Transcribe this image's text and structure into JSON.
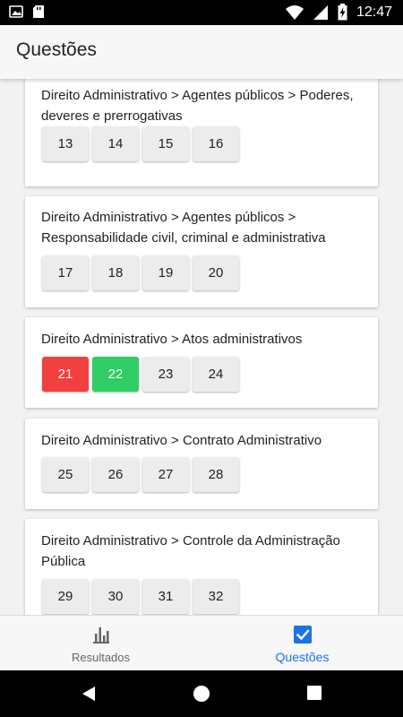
{
  "status_bar": {
    "time": "12:47"
  },
  "app_bar": {
    "title": "Questões"
  },
  "sections": [
    {
      "title": "Direito Administrativo > Agentes públicos > Poderes, deveres e prerrogativas",
      "questions": [
        {
          "n": "13",
          "status": "none"
        },
        {
          "n": "14",
          "status": "none"
        },
        {
          "n": "15",
          "status": "none"
        },
        {
          "n": "16",
          "status": "none"
        }
      ]
    },
    {
      "title": "Direito Administrativo > Agentes públicos > Responsabilidade civil, criminal e administrativa",
      "questions": [
        {
          "n": "17",
          "status": "none"
        },
        {
          "n": "18",
          "status": "none"
        },
        {
          "n": "19",
          "status": "none"
        },
        {
          "n": "20",
          "status": "none"
        }
      ]
    },
    {
      "title": "Direito Administrativo > Atos administrativos",
      "questions": [
        {
          "n": "21",
          "status": "wrong"
        },
        {
          "n": "22",
          "status": "right"
        },
        {
          "n": "23",
          "status": "none"
        },
        {
          "n": "24",
          "status": "none"
        }
      ]
    },
    {
      "title": "Direito Administrativo > Contrato Administrativo",
      "questions": [
        {
          "n": "25",
          "status": "none"
        },
        {
          "n": "26",
          "status": "none"
        },
        {
          "n": "27",
          "status": "none"
        },
        {
          "n": "28",
          "status": "none"
        }
      ]
    },
    {
      "title": "Direito Administrativo > Controle da Administração Pública",
      "questions": [
        {
          "n": "29",
          "status": "none"
        },
        {
          "n": "30",
          "status": "none"
        },
        {
          "n": "31",
          "status": "none"
        },
        {
          "n": "32",
          "status": "none"
        }
      ]
    }
  ],
  "bottom_nav": {
    "items": [
      {
        "label": "Resultados",
        "icon": "bar-chart-icon",
        "active": false
      },
      {
        "label": "Questões",
        "icon": "checkbox-icon",
        "active": true
      }
    ]
  },
  "colors": {
    "wrong": "#f14040",
    "right": "#30cd64",
    "accent": "#1a73e8"
  }
}
